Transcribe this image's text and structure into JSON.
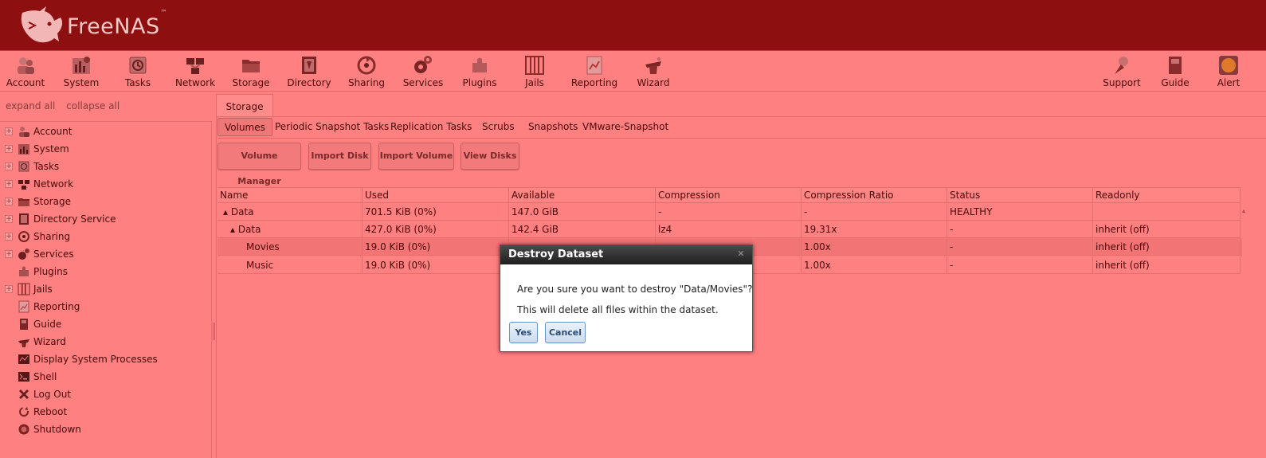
{
  "app": {
    "name": "FreeNAS"
  },
  "colors": {
    "header": "#8e0f0f",
    "overlay": "#ff8080",
    "dialog_title": "#2a2a2a"
  },
  "toolbar": {
    "left": [
      {
        "label": "Account",
        "icon": "account-icon"
      },
      {
        "label": "System",
        "icon": "system-icon"
      },
      {
        "label": "Tasks",
        "icon": "tasks-icon"
      },
      {
        "label": "Network",
        "icon": "network-icon"
      },
      {
        "label": "Storage",
        "icon": "storage-icon"
      },
      {
        "label": "Directory",
        "icon": "directory-icon"
      },
      {
        "label": "Sharing",
        "icon": "sharing-icon"
      },
      {
        "label": "Services",
        "icon": "services-icon"
      },
      {
        "label": "Plugins",
        "icon": "plugins-icon"
      },
      {
        "label": "Jails",
        "icon": "jails-icon"
      },
      {
        "label": "Reporting",
        "icon": "reporting-icon"
      },
      {
        "label": "Wizard",
        "icon": "wizard-icon"
      }
    ],
    "right": [
      {
        "label": "Support",
        "icon": "support-icon"
      },
      {
        "label": "Guide",
        "icon": "guide-icon"
      },
      {
        "label": "Alert",
        "icon": "alert-icon"
      }
    ]
  },
  "sidebar": {
    "expand_all": "expand all",
    "collapse_all": "collapse all",
    "items": [
      {
        "label": "Account",
        "expandable": true
      },
      {
        "label": "System",
        "expandable": true
      },
      {
        "label": "Tasks",
        "expandable": true
      },
      {
        "label": "Network",
        "expandable": true
      },
      {
        "label": "Storage",
        "expandable": true
      },
      {
        "label": "Directory Service",
        "expandable": true
      },
      {
        "label": "Sharing",
        "expandable": true
      },
      {
        "label": "Services",
        "expandable": true
      },
      {
        "label": "Plugins",
        "expandable": false
      },
      {
        "label": "Jails",
        "expandable": true
      },
      {
        "label": "Reporting",
        "expandable": false
      },
      {
        "label": "Guide",
        "expandable": false
      },
      {
        "label": "Wizard",
        "expandable": false
      },
      {
        "label": "Display System Processes",
        "expandable": false
      },
      {
        "label": "Shell",
        "expandable": false
      },
      {
        "label": "Log Out",
        "expandable": false
      },
      {
        "label": "Reboot",
        "expandable": false
      },
      {
        "label": "Shutdown",
        "expandable": false
      }
    ]
  },
  "main": {
    "tab": "Storage",
    "subtabs": [
      "Volumes",
      "Periodic Snapshot Tasks",
      "Replication Tasks",
      "Scrubs",
      "Snapshots",
      "VMware-Snapshot"
    ],
    "buttons": [
      "Volume Manager",
      "Import Disk",
      "Import Volume",
      "View Disks"
    ],
    "columns": [
      "Name",
      "Used",
      "Available",
      "Compression",
      "Compression Ratio",
      "Status",
      "Readonly"
    ],
    "rows": [
      {
        "name": "▴ Data",
        "used": "701.5 KiB (0%)",
        "available": "147.0 GiB",
        "compression": "-",
        "ratio": "-",
        "status": "HEALTHY",
        "readonly": ""
      },
      {
        "name": "▴ Data",
        "used": "427.0 KiB (0%)",
        "available": "142.4 GiB",
        "compression": "lz4",
        "ratio": "19.31x",
        "status": "-",
        "readonly": "inherit (off)"
      },
      {
        "name": "Movies",
        "used": "19.0 KiB (0%)",
        "available": "",
        "compression": "",
        "ratio": "1.00x",
        "status": "-",
        "readonly": "inherit (off)"
      },
      {
        "name": "Music",
        "used": "19.0 KiB (0%)",
        "available": "",
        "compression": "",
        "ratio": "1.00x",
        "status": "-",
        "readonly": "inherit (off)"
      }
    ]
  },
  "dialog": {
    "title": "Destroy Dataset",
    "message": "Are you sure you want to destroy \"Data/Movies\"?",
    "warning": "This will delete all files within the dataset.",
    "yes": "Yes",
    "cancel": "Cancel",
    "close_icon": "close-icon"
  }
}
